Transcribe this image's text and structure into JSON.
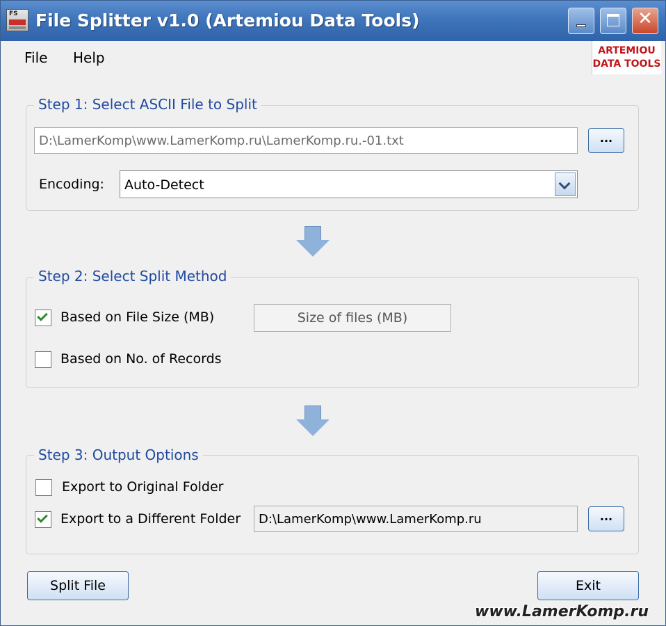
{
  "window": {
    "title": "File Splitter v1.0 (Artemiou Data Tools)",
    "icon_text": "FS"
  },
  "menu": {
    "file": "File",
    "help": "Help"
  },
  "brand": {
    "line1": "ARTEMIOU",
    "line2": "DATA TOOLS",
    "color": "#c0161b"
  },
  "step1": {
    "legend": "Step 1: Select ASCII File to Split",
    "file_path": "D:\\LamerKomp\\www.LamerKomp.ru\\LamerKomp.ru.-01.txt",
    "browse_label": "...",
    "encoding_label": "Encoding:",
    "encoding_value": "Auto-Detect"
  },
  "step2": {
    "legend": "Step 2: Select Split Method",
    "by_size": {
      "label": "Based on File Size (MB)",
      "checked": true
    },
    "size_placeholder": "Size of files (MB)",
    "by_records": {
      "label": "Based on No. of Records",
      "checked": false
    }
  },
  "step3": {
    "legend": "Step 3: Output Options",
    "original_folder": {
      "label": "Export to Original Folder",
      "checked": false
    },
    "different_folder": {
      "label": "Export to a Different Folder",
      "checked": true
    },
    "output_path": "D:\\LamerKomp\\www.LamerKomp.ru",
    "browse_label": "..."
  },
  "buttons": {
    "split": "Split File",
    "exit": "Exit"
  },
  "watermark": "www.LamerKomp.ru",
  "colors": {
    "accent": "#1f4aa0",
    "check": "#2d8a2d",
    "title_bar": "#3f75bb"
  }
}
